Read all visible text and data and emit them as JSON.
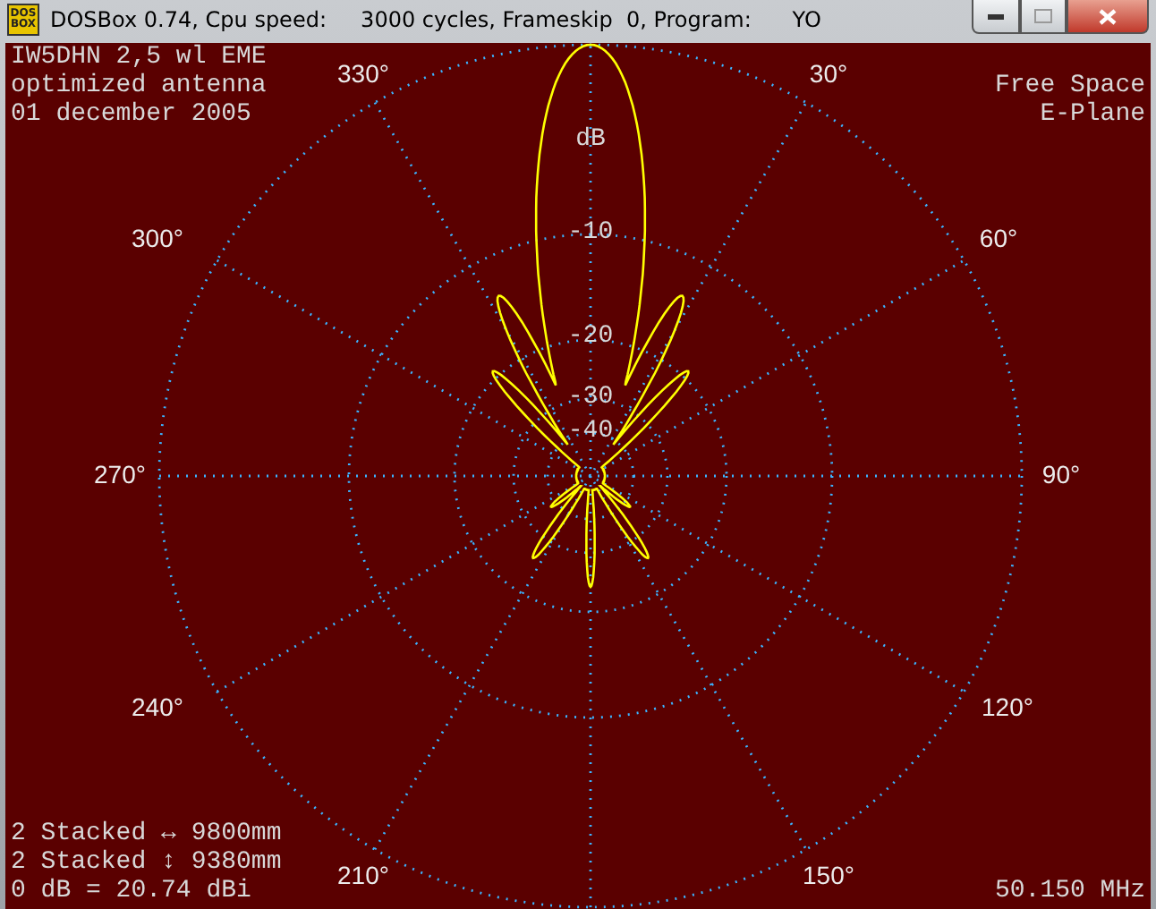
{
  "window": {
    "logo": [
      "DOS",
      "BOX"
    ],
    "title": "DOSBox 0.74, Cpu speed:     3000 cycles, Frameskip  0, Program:      YO"
  },
  "header_left": [
    "IW5DHN 2,5 wl EME",
    "optimized antenna",
    "01 december 2005"
  ],
  "header_right": [
    "Free Space",
    "E-Plane"
  ],
  "plot": {
    "db_labels": [
      "dB",
      "-10",
      "-20",
      "-30",
      "-40"
    ],
    "angle_labels": [
      "330°",
      "30°",
      "300°",
      "60°",
      "270°",
      "90°",
      "240°",
      "120°",
      "210°",
      "150°"
    ]
  },
  "footer_left": [
    "2 Stacked ↔ 9800mm",
    "2 Stacked ↕ 9380mm",
    "0 dB = 20.74 dBi"
  ],
  "footer_right": "50.150 MHz"
}
